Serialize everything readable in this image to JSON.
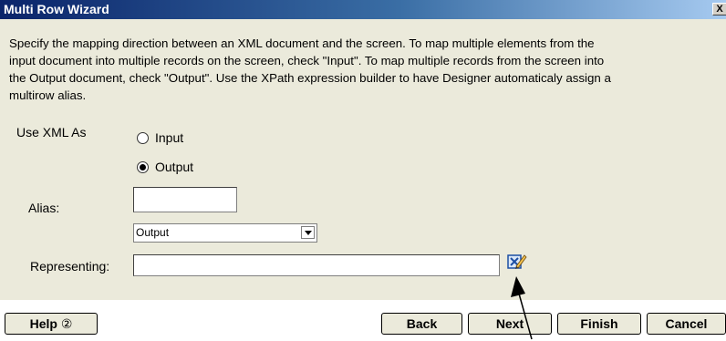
{
  "window": {
    "title": "Multi Row Wizard",
    "close_glyph": "X"
  },
  "description": "Specify the mapping direction between an XML document and the screen. To map multiple elements from the\ninput document into multiple records on the screen, check \"Input\". To map multiple records from the screen into\nthe Output document, check \"Output\". Use the XPath expression builder to have Designer automaticaly assign a\nmultirow alias.",
  "use_xml_as": {
    "label": "Use XML As",
    "options": [
      {
        "label": "Input",
        "selected": false
      },
      {
        "label": "Output",
        "selected": true
      }
    ]
  },
  "alias": {
    "label": "Alias:",
    "value": "",
    "dropdown_value": "Output"
  },
  "representing": {
    "label": "Representing:",
    "value": "",
    "xpath_button_icon": "xpath-builder-icon"
  },
  "buttons": {
    "help": "Help",
    "help_icon": "②",
    "back": "Back",
    "next": "Next",
    "finish": "Finish",
    "cancel": "Cancel"
  }
}
